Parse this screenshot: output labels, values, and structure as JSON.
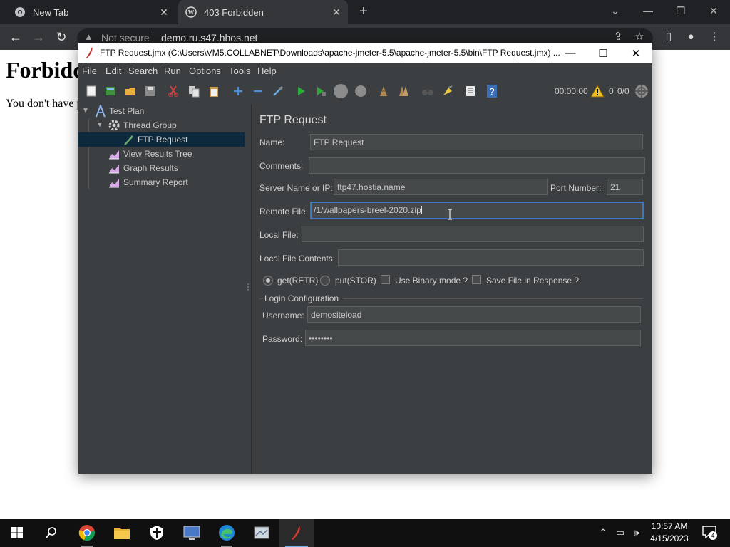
{
  "browser": {
    "tabs": [
      {
        "title": "New Tab"
      },
      {
        "title": "403 Forbidden"
      }
    ],
    "security_label": "Not secure",
    "url": "demo.ru.s47.hhos.net"
  },
  "webpage": {
    "heading": "Forbidden",
    "message": "You don't have permission to access this resource."
  },
  "jmeter": {
    "window_title": "FTP Request.jmx (C:\\Users\\VM5.COLLABNET\\Downloads\\apache-jmeter-5.5\\apache-jmeter-5.5\\bin\\FTP Request.jmx) ...",
    "menu": [
      "File",
      "Edit",
      "Search",
      "Run",
      "Options",
      "Tools",
      "Help"
    ],
    "status": {
      "elapsed": "00:00:00",
      "error_count": "0",
      "threads": "0/0"
    },
    "tree": {
      "items": [
        {
          "label": "Test Plan"
        },
        {
          "label": "Thread Group"
        },
        {
          "label": "FTP Request"
        },
        {
          "label": "View Results Tree"
        },
        {
          "label": "Graph Results"
        },
        {
          "label": "Summary Report"
        }
      ]
    },
    "form": {
      "heading": "FTP Request",
      "name_label": "Name:",
      "name_value": "FTP Request",
      "comments_label": "Comments:",
      "comments_value": "",
      "server_label": "Server Name or IP:",
      "server_value": "ftp47.hostia.name",
      "port_label": "Port Number:",
      "port_value": "21",
      "remote_label": "Remote File:",
      "remote_value": "/1/wallpapers-breel-2020.zip",
      "local_label": "Local File:",
      "local_value": "",
      "local_contents_label": "Local File Contents:",
      "local_contents_value": "",
      "radio_get_label": "get(RETR)",
      "radio_put_label": "put(STOR)",
      "selected_mode": "get(RETR)",
      "binary_label": "Use Binary mode ?",
      "binary_checked": false,
      "save_label": "Save File in Response ?",
      "save_checked": false,
      "login_group_label": "Login Configuration",
      "username_label": "Username:",
      "username_value": "demositeload",
      "password_label": "Password:",
      "password_value": "••••••••"
    }
  },
  "taskbar": {
    "time": "10:57 AM",
    "date": "4/15/2023",
    "notification_count": "4"
  },
  "colors": {
    "jmeter_bg": "#3c3f41",
    "selection": "#0d293e",
    "focus_border": "#3d76c2",
    "chrome_dark": "#202124"
  }
}
